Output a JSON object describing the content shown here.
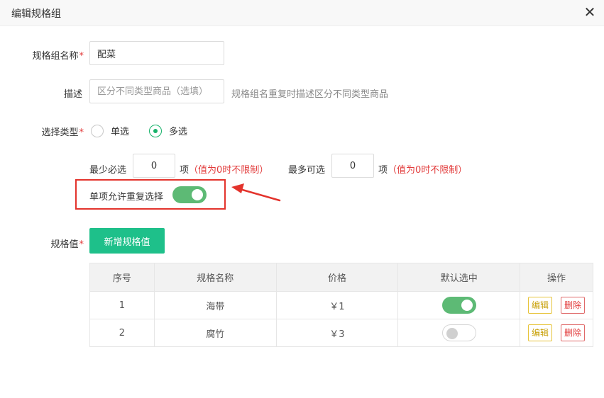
{
  "dialog": {
    "title": "编辑规格组"
  },
  "form": {
    "name_label": "规格组名称",
    "name_value": "配菜",
    "desc_label": "描述",
    "desc_placeholder": "区分不同类型商品（选填）",
    "desc_hint": "规格组名重复时描述区分不同类型商品",
    "type_label": "选择类型",
    "type_options": [
      {
        "label": "单选",
        "checked": false
      },
      {
        "label": "多选",
        "checked": true
      }
    ],
    "required_asterisk": "*"
  },
  "multi": {
    "min_label": "最少必选",
    "min_value": "0",
    "min_unit": "项",
    "min_note": "（值为0时不限制）",
    "max_label": "最多可选",
    "max_value": "0",
    "max_unit": "项",
    "max_note": "（值为0时不限制）",
    "repeat_label": "单项允许重复选择",
    "repeat_on": true
  },
  "spec_values": {
    "label": "规格值",
    "add_button": "新增规格值",
    "columns": [
      "序号",
      "规格名称",
      "价格",
      "默认选中",
      "操作"
    ],
    "rows": [
      {
        "index": "1",
        "name": "海带",
        "price": "￥1",
        "default": true,
        "edit": "编辑",
        "delete": "删除"
      },
      {
        "index": "2",
        "name": "腐竹",
        "price": "￥3",
        "default": false,
        "edit": "编辑",
        "delete": "删除"
      }
    ]
  },
  "colors": {
    "accent_green": "#1ec08a",
    "switch_green": "#5dba75",
    "highlight_red": "#e3332c",
    "required_red": "#e23c3c"
  },
  "icons": {
    "close": "close-icon",
    "arrow": "red-arrow-annotation-icon"
  }
}
